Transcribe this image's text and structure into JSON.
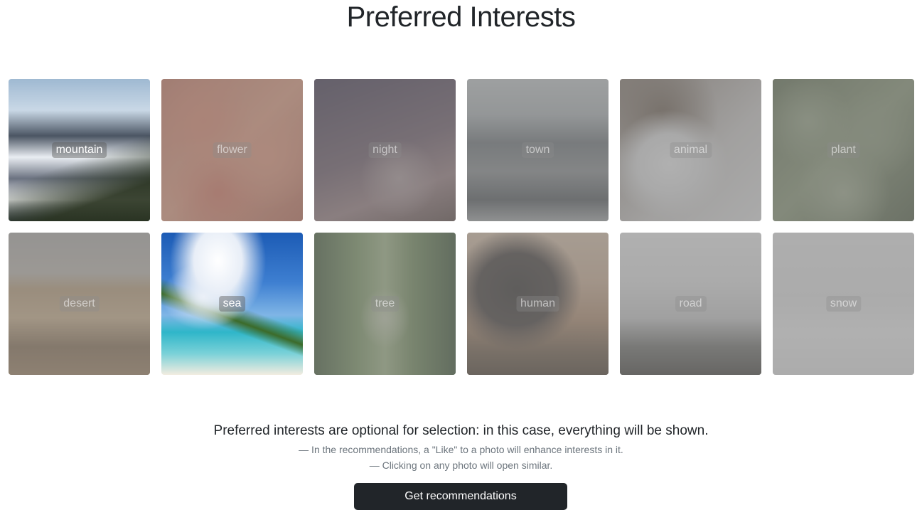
{
  "page": {
    "title": "Preferred Interests"
  },
  "interests": [
    {
      "label": "mountain",
      "selected": true,
      "art": "art-mountain"
    },
    {
      "label": "flower",
      "selected": false,
      "art": "art-flower"
    },
    {
      "label": "night",
      "selected": false,
      "art": "art-night"
    },
    {
      "label": "town",
      "selected": false,
      "art": "art-town"
    },
    {
      "label": "animal",
      "selected": false,
      "art": "art-animal"
    },
    {
      "label": "plant",
      "selected": false,
      "art": "art-plant"
    },
    {
      "label": "desert",
      "selected": false,
      "art": "art-desert"
    },
    {
      "label": "sea",
      "selected": true,
      "art": "art-sea"
    },
    {
      "label": "tree",
      "selected": false,
      "art": "art-tree"
    },
    {
      "label": "human",
      "selected": false,
      "art": "art-human"
    },
    {
      "label": "road",
      "selected": false,
      "art": "art-road"
    },
    {
      "label": "snow",
      "selected": false,
      "art": "art-snow"
    }
  ],
  "info": {
    "main": "Preferred interests are optional for selection: in this case, everything will be shown.",
    "line1": "— In the recommendations, a \"Like\" to a photo will enhance interests in it.",
    "line2": "— Clicking on any photo will open similar."
  },
  "actions": {
    "cta_label": "Get recommendations"
  },
  "colors": {
    "cta_background": "#212529",
    "text_muted": "#6c757d"
  }
}
